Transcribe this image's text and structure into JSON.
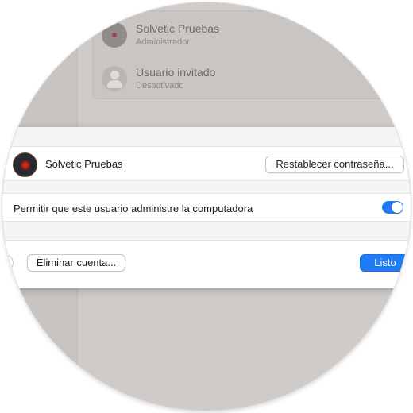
{
  "background": {
    "users": [
      {
        "name": "Solvetic Pruebas",
        "role": "Administrador"
      },
      {
        "name": "Usuario invitado",
        "role": "Desactivado"
      }
    ]
  },
  "dialog": {
    "user_name": "Solvetic Pruebas",
    "reset_password_label": "Restablecer contraseña...",
    "admin_permission_label": "Permitir que este usuario administre la computadora",
    "admin_permission_enabled": true,
    "help_label": "?",
    "delete_account_label": "Eliminar cuenta...",
    "done_label": "Listo"
  },
  "colors": {
    "accent": "#1f7cf5",
    "backdrop": "#cfcbc9",
    "dialog_bg": "#f5f5f5"
  }
}
